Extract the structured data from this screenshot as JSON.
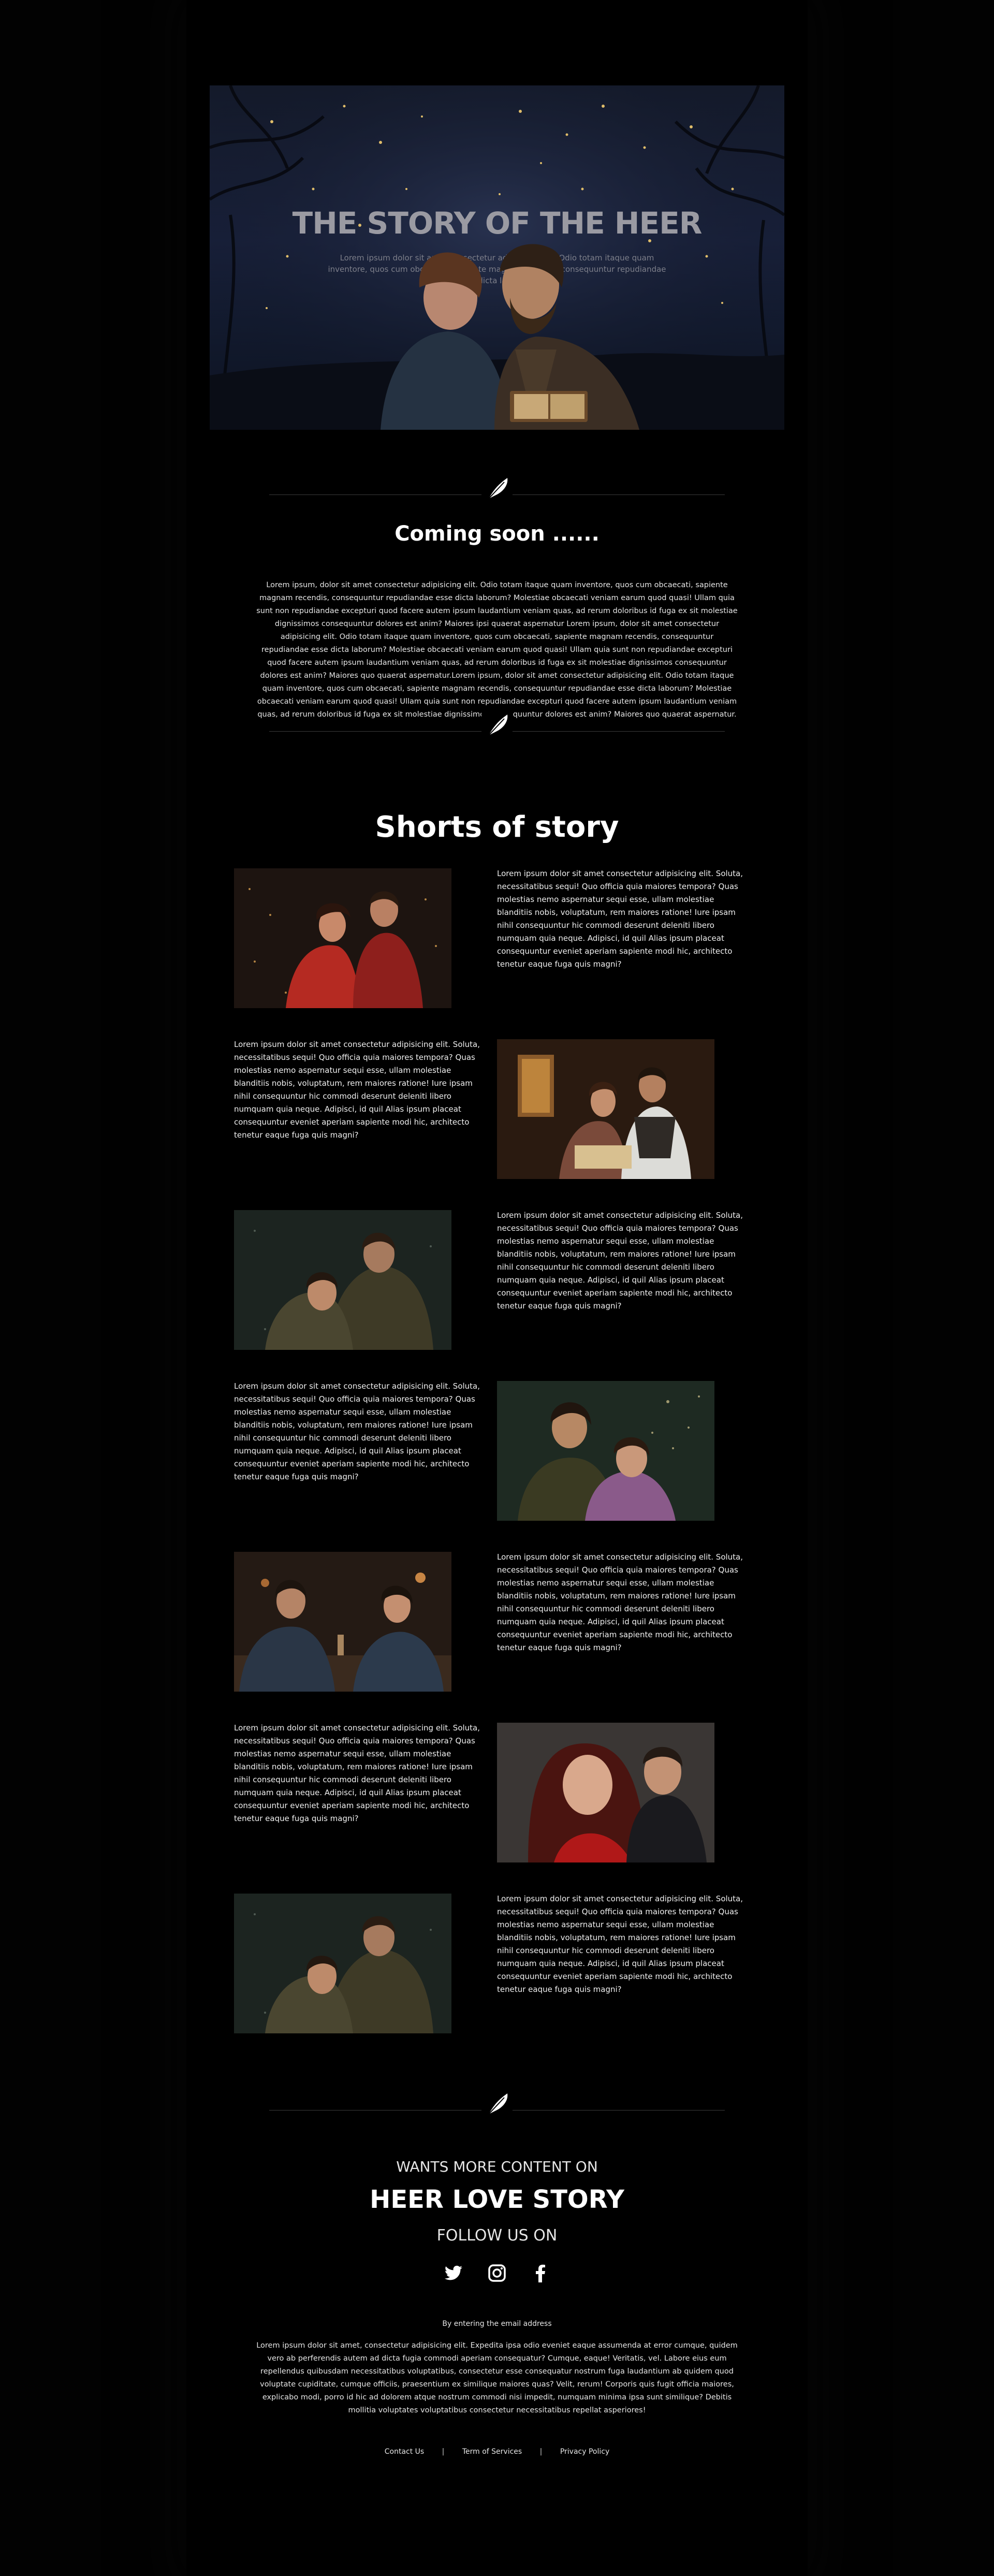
{
  "hero": {
    "title": "THE STORY OF THE HEER",
    "subtitle": "Lorem ipsum dolor sit amet consectetur adipisicing elit. Odio totam itaque quam inventore, quos cum obcaecati, sapiente magnam recendis consequuntur repudiandae esse dicta laborum?"
  },
  "coming": {
    "title": "Coming soon ......",
    "body": "Lorem ipsum, dolor sit amet consectetur adipisicing elit. Odio totam itaque quam inventore, quos cum obcaecati, sapiente magnam recendis, consequuntur repudiandae esse dicta laborum? Molestiae obcaecati veniam earum quod quasi! Ullam quia sunt non repudiandae excepturi quod facere autem ipsum laudantium veniam quas, ad rerum doloribus id fuga ex sit molestiae dignissimos consequuntur dolores est anim? Maiores ipsi quaerat aspernatur Lorem ipsum, dolor sit amet consectetur adipisicing elit. Odio totam itaque quam inventore, quos cum obcaecati, sapiente magnam recendis, consequuntur repudiandae esse dicta laborum? Molestiae obcaecati veniam earum quod quasi! Ullam quia sunt non repudiandae excepturi quod facere autem ipsum laudantium veniam quas, ad rerum doloribus id fuga ex sit molestiae dignissimos consequuntur dolores est anim? Maiores quo quaerat aspernatur.Lorem ipsum, dolor sit amet consectetur adipisicing elit. Odio totam itaque quam inventore, quos cum obcaecati, sapiente magnam recendis, consequuntur repudiandae esse dicta laborum? Molestiae obcaecati veniam earum quod quasi! Ullam quia sunt non repudiandae excepturi quod facere autem ipsum laudantium veniam quas, ad rerum doloribus id fuga ex sit molestiae dignissimos consequuntur dolores est anim? Maiores quo quaerat aspernatur."
  },
  "shorts": {
    "title": "Shorts of story",
    "stories": [
      {
        "text": "Lorem ipsum dolor sit amet consectetur adipisicing elit. Soluta, necessitatibus sequi! Quo officia quia maiores tempora? Quas molestias nemo aspernatur sequi esse, ullam molestiae blanditiis nobis, voluptatum, rem maiores ratione! Iure ipsam nihil consequuntur hic commodi deserunt deleniti libero numquam quia neque. Adipisci, id quil Alias ipsum placeat consequuntur eveniet aperiam sapiente modi hic, architecto tenetur eaque fuga quis magni?"
      },
      {
        "text": "Lorem ipsum dolor sit amet consectetur adipisicing elit. Soluta, necessitatibus sequi! Quo officia quia maiores tempora? Quas molestias nemo aspernatur sequi esse, ullam molestiae blanditiis nobis, voluptatum, rem maiores ratione! Iure ipsam nihil consequuntur hic commodi deserunt deleniti libero numquam quia neque. Adipisci, id quil Alias ipsum placeat consequuntur eveniet aperiam sapiente modi hic, architecto tenetur eaque fuga quis magni?"
      },
      {
        "text": "Lorem ipsum dolor sit amet consectetur adipisicing elit. Soluta, necessitatibus sequi! Quo officia quia maiores tempora? Quas molestias nemo aspernatur sequi esse, ullam molestiae blanditiis nobis, voluptatum, rem maiores ratione! Iure ipsam nihil consequuntur hic commodi deserunt deleniti libero numquam quia neque. Adipisci, id quil Alias ipsum placeat consequuntur eveniet aperiam sapiente modi hic, architecto tenetur eaque fuga quis magni?"
      },
      {
        "text": "Lorem ipsum dolor sit amet consectetur adipisicing elit. Soluta, necessitatibus sequi! Quo officia quia maiores tempora? Quas molestias nemo aspernatur sequi esse, ullam molestiae blanditiis nobis, voluptatum, rem maiores ratione! Iure ipsam nihil consequuntur hic commodi deserunt deleniti libero numquam quia neque. Adipisci, id quil Alias ipsum placeat consequuntur eveniet aperiam sapiente modi hic, architecto tenetur eaque fuga quis magni?"
      },
      {
        "text": "Lorem ipsum dolor sit amet consectetur adipisicing elit. Soluta, necessitatibus sequi! Quo officia quia maiores tempora? Quas molestias nemo aspernatur sequi esse, ullam molestiae blanditiis nobis, voluptatum, rem maiores ratione! Iure ipsam nihil consequuntur hic commodi deserunt deleniti libero numquam quia neque. Adipisci, id quil Alias ipsum placeat consequuntur eveniet aperiam sapiente modi hic, architecto tenetur eaque fuga quis magni?"
      },
      {
        "text": "Lorem ipsum dolor sit amet consectetur adipisicing elit. Soluta, necessitatibus sequi! Quo officia quia maiores tempora? Quas molestias nemo aspernatur sequi esse, ullam molestiae blanditiis nobis, voluptatum, rem maiores ratione! Iure ipsam nihil consequuntur hic commodi deserunt deleniti libero numquam quia neque. Adipisci, id quil Alias ipsum placeat consequuntur eveniet aperiam sapiente modi hic, architecto tenetur eaque fuga quis magni?"
      },
      {
        "text": "Lorem ipsum dolor sit amet consectetur adipisicing elit. Soluta, necessitatibus sequi! Quo officia quia maiores tempora? Quas molestias nemo aspernatur sequi esse, ullam molestiae blanditiis nobis, voluptatum, rem maiores ratione! Iure ipsam nihil consequuntur hic commodi deserunt deleniti libero numquam quia neque. Adipisci, id quil Alias ipsum placeat consequuntur eveniet aperiam sapiente modi hic, architecto tenetur eaque fuga quis magni?"
      }
    ]
  },
  "footer": {
    "wants": "WANTS MORE CONTENT ON",
    "brand": "HEER LOVE STORY",
    "follow": "FOLLOW US ON",
    "social_icons": [
      "twitter-icon",
      "instagram-icon",
      "facebook-icon"
    ],
    "email_note": "By entering the email address",
    "body": "Lorem ipsum dolor sit amet, consectetur adipisicing elit. Expedita ipsa odio eveniet eaque assumenda at error cumque, quidem vero ab perferendis autem ad dicta fugia commodi aperiam consequatur? Cumque, eaque! Veritatis, vel. Labore eius eum repellendus quibusdam necessitatibus voluptatibus, consectetur esse consequatur nostrum fuga laudantium ab quidem quod voluptate cupiditate, cumque officiis, praesentium ex similique maiores quas? Velit, rerum! Corporis quis fugit officia maiores, explicabo modi, porro id hic ad dolorem atque nostrum commodi nisi impedit, numquam minima ipsa sunt similique? Debitis mollitia voluptates voluptatibus consectetur necessitatibus repellat asperiores!",
    "links": [
      "Contact Us",
      "Term of Services",
      "Privacy Policy"
    ],
    "separator": "|"
  },
  "colors": {
    "background": "#000000",
    "text": "#ffffff",
    "hero_title": "#9a9aa2",
    "divider": "#3a3a3a"
  }
}
